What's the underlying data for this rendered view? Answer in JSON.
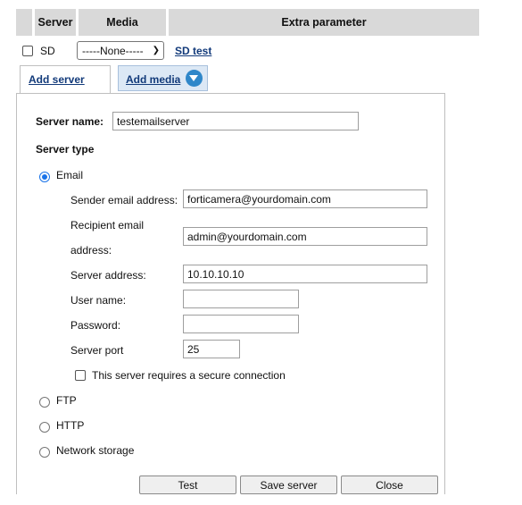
{
  "header": {
    "columns": [
      "Server",
      "Media",
      "Extra parameter"
    ]
  },
  "row": {
    "server_label": "SD",
    "media_select": "-----None-----",
    "test_link": "SD test"
  },
  "tabs": {
    "add_server": "Add server",
    "add_media": "Add media"
  },
  "form": {
    "server_name_label": "Server name:",
    "server_name_value": "testemailserver",
    "server_type_label": "Server type",
    "email_option": "Email",
    "sender_label": "Sender email address:",
    "sender_value": "forticamera@yourdomain.com",
    "recipient_label_line1": "Recipient email",
    "recipient_label_line2": "address:",
    "recipient_value": "admin@yourdomain.com",
    "server_address_label": "Server address:",
    "server_address_value": "10.10.10.10",
    "user_name_label": "User name:",
    "user_name_value": "",
    "password_label": "Password:",
    "password_value": "",
    "server_port_label": "Server port",
    "server_port_value": "25",
    "secure_label": "This server requires a secure connection",
    "ftp_option": "FTP",
    "http_option": "HTTP",
    "network_storage_option": "Network storage"
  },
  "buttons": {
    "test": "Test",
    "save": "Save server",
    "close": "Close"
  }
}
